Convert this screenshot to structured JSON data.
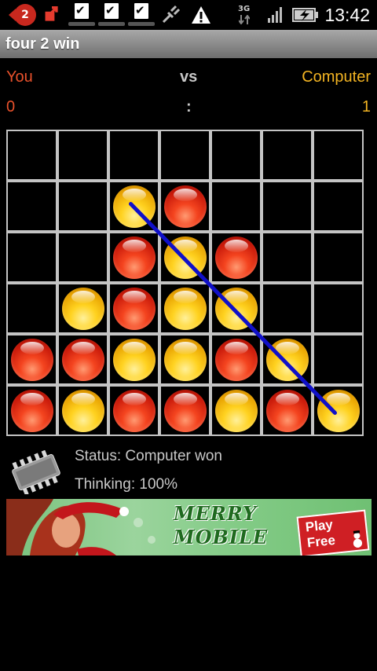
{
  "status_bar": {
    "notification_count": "2",
    "network_label": "3G",
    "time": "13:42"
  },
  "app": {
    "title": "four 2 win"
  },
  "players": {
    "left_label": "You",
    "middle_label": "vs",
    "right_label": "Computer",
    "left_score": "0",
    "separator": ":",
    "right_score": "1",
    "left_color": "#e8512b",
    "right_color": "#f2b322"
  },
  "board": {
    "columns": 7,
    "rows": 6,
    "grid": [
      [
        "",
        "",
        "",
        "",
        "",
        "",
        ""
      ],
      [
        "",
        "",
        "Y",
        "R",
        "",
        "",
        ""
      ],
      [
        "",
        "",
        "R",
        "Y",
        "R",
        "",
        ""
      ],
      [
        "",
        "Y",
        "R",
        "Y",
        "Y",
        "",
        ""
      ],
      [
        "R",
        "R",
        "Y",
        "Y",
        "R",
        "Y",
        ""
      ],
      [
        "R",
        "Y",
        "R",
        "R",
        "Y",
        "R",
        "Y"
      ]
    ],
    "winning_line": {
      "from": [
        1,
        2
      ],
      "to": [
        5,
        6
      ],
      "color": "#1010c8"
    }
  },
  "status": {
    "status_text": "Status: Computer won",
    "thinking_text": "Thinking: 100%"
  },
  "ad_banner": {
    "brand": "MERRY MOBILE",
    "cta_line1": "Play",
    "cta_line2": "Free"
  }
}
